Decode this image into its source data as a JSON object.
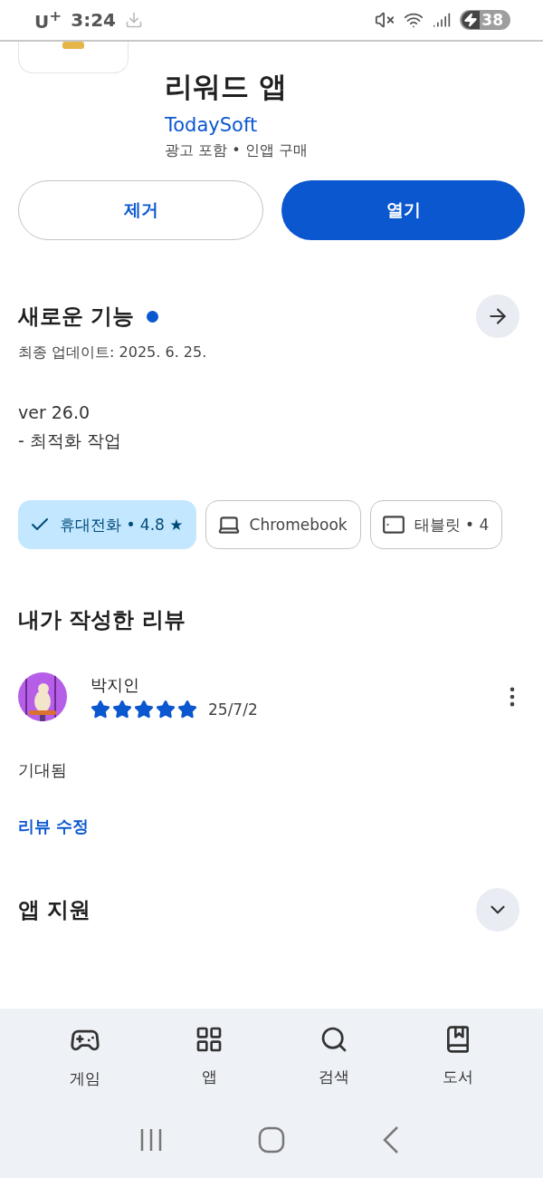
{
  "status_bar": {
    "carrier": "U$^{+}$",
    "time": "3:24",
    "battery": "38"
  },
  "app": {
    "title": "리워드 앱",
    "developer": "TodaySoft",
    "meta": "광고 포함 • 인앱 구매"
  },
  "buttons": [
    {
      "label": "제거",
      "kind": "outlined"
    },
    {
      "label": "열기",
      "kind": "filled"
    }
  ],
  "whats_new": {
    "title": "새로운 기능",
    "new_dot": true,
    "updated": "최종 업데이트: 2025. 6. 25.",
    "lines": [
      "ver 26.0",
      "- 최적화 작업"
    ]
  },
  "device_chips": [
    {
      "label": "휴대전화 • 4.8 ★",
      "kind": "phone",
      "selected": true
    },
    {
      "label": "Chromebook",
      "kind": "laptop",
      "selected": false
    },
    {
      "label": "태블릿 • 4",
      "kind": "tablet",
      "selected": false
    }
  ],
  "review": {
    "heading": "내가 작성한 리뷰",
    "author": "박지인",
    "stars": 5,
    "date": "25/7/2",
    "text": "기대됨",
    "edit_link": "리뷰 수정"
  },
  "sections": [
    {
      "title": "앱 지원",
      "kind": "expand"
    }
  ],
  "bottom_nav": [
    {
      "label": "게임",
      "kind": "games"
    },
    {
      "label": "앱",
      "kind": "apps"
    },
    {
      "label": "검색",
      "kind": "search"
    },
    {
      "label": "도서",
      "kind": "books"
    }
  ]
}
